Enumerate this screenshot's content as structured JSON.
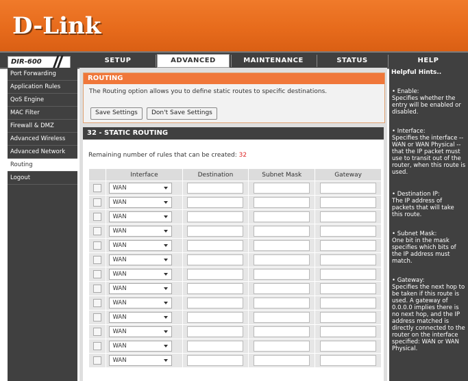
{
  "brand": "D-Link",
  "model": "DIR-600",
  "tabs": [
    "SETUP",
    "ADVANCED",
    "MAINTENANCE",
    "STATUS",
    "HELP"
  ],
  "sidebar": [
    "Port Forwarding",
    "Application Rules",
    "QoS Engine",
    "MAC Filter",
    "Firewall & DMZ",
    "Advanced Wireless",
    "Advanced Network",
    "Routing",
    "Logout"
  ],
  "routing": {
    "title": "ROUTING",
    "description": "The Routing option allows you to define static routes to specific destinations.",
    "save_label": "Save Settings",
    "dont_save_label": "Don't Save Settings"
  },
  "static": {
    "title": "32 - STATIC ROUTING",
    "remaining_label": "Remaining number of rules that can be created:",
    "remaining_count": "32",
    "headers": [
      "Interface",
      "Destination",
      "Subnet Mask",
      "Gateway"
    ],
    "interface_value": "WAN"
  },
  "help": {
    "title": "Helpful Hints..",
    "enable": "• Enable:\nSpecifies whether the entry will be enabled or disabled.",
    "interface": "• Interface:\nSpecifies the interface -- WAN or WAN Physical -- that the IP packet must use to transit out of the router, when this route is used.",
    "destination": "• Destination IP:\nThe IP address of packets that will take this route.",
    "subnet": "• Subnet Mask:\nOne bit in the mask specifies which bits of the IP address must match.",
    "gateway": "• Gateway:\nSpecifies the next hop to be taken if this route is used. A gateway of 0.0.0.0 implies there is no next hop, and the IP address matched is directly connected to the router on the interface specified: WAN or WAN Physical."
  },
  "colors": {
    "accent": "#f0773a",
    "dark": "#404040",
    "count": "#d22222"
  }
}
